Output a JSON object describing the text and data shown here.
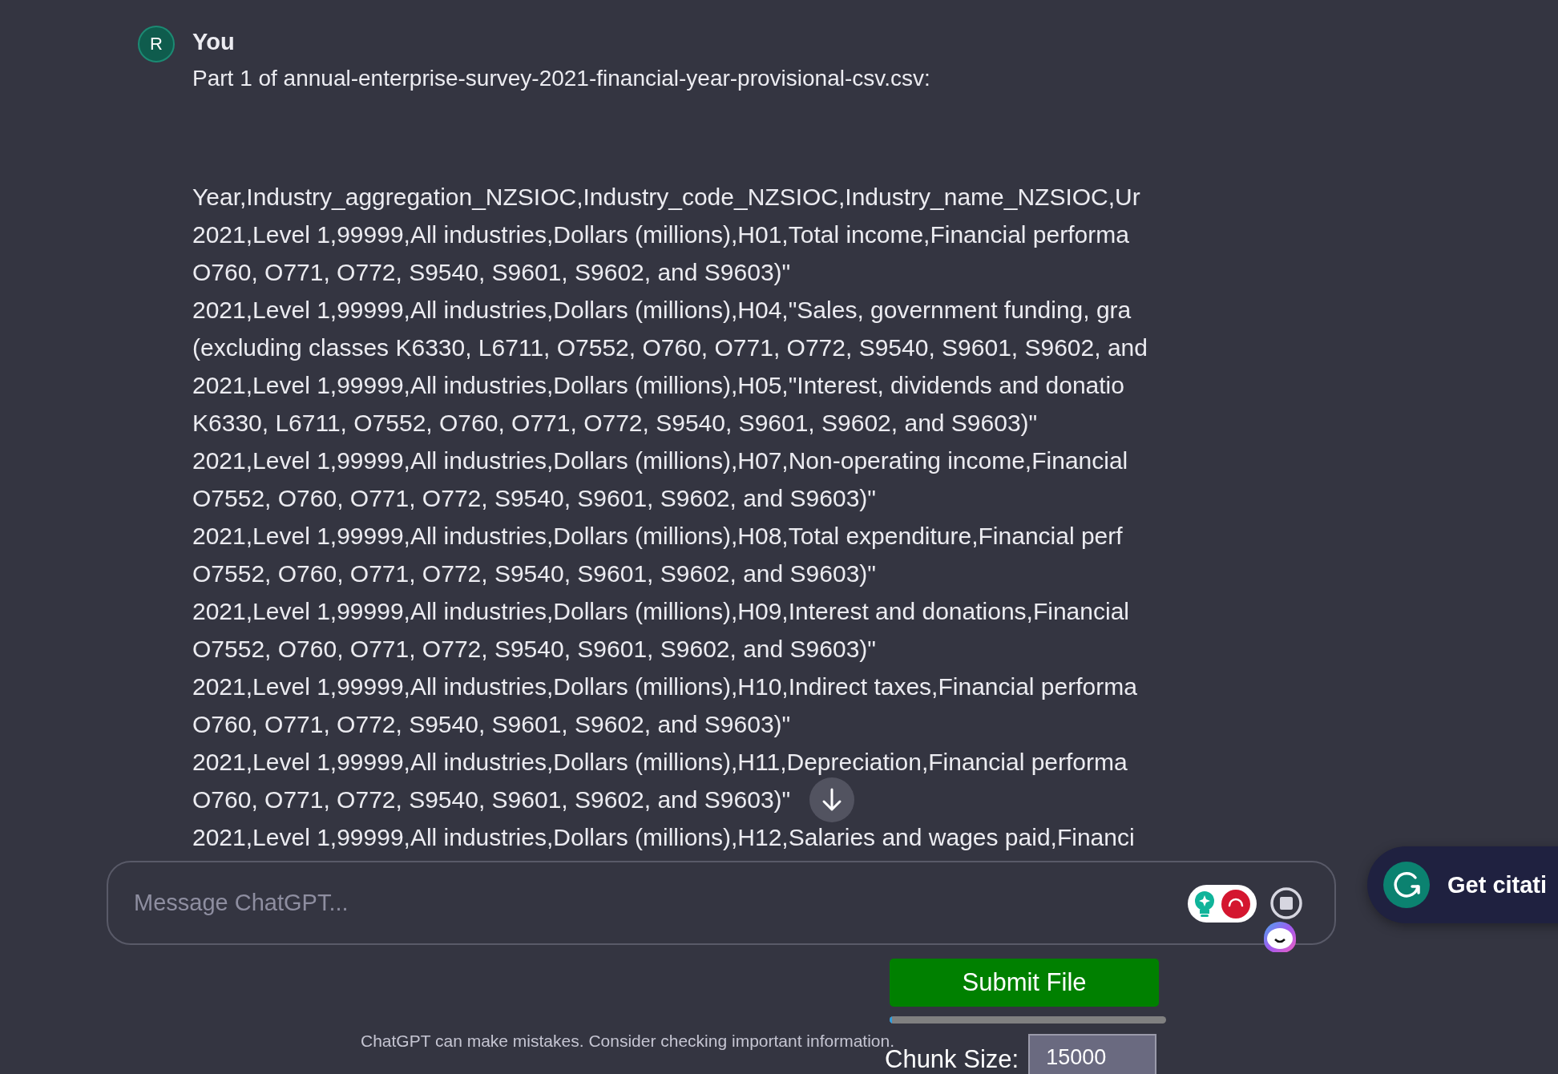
{
  "message": {
    "avatar": "R",
    "author": "You",
    "heading": "Part 1 of annual-enterprise-survey-2021-financial-year-provisional-csv.csv:",
    "lines": [
      "Year,Industry_aggregation_NZSIOC,Industry_code_NZSIOC,Industry_name_NZSIOC,Ur",
      "2021,Level 1,99999,All industries,Dollars (millions),H01,Total income,Financial performa",
      "O760, O771, O772, S9540, S9601, S9602, and S9603)\"",
      "2021,Level 1,99999,All industries,Dollars (millions),H04,\"Sales, government funding, gra",
      "(excluding classes K6330, L6711, O7552, O760, O771, O772, S9540, S9601, S9602, and",
      "2021,Level 1,99999,All industries,Dollars (millions),H05,\"Interest, dividends and donatio",
      "K6330, L6711, O7552, O760, O771, O772, S9540, S9601, S9602, and S9603)\"",
      "2021,Level 1,99999,All industries,Dollars (millions),H07,Non-operating income,Financial",
      "O7552, O760, O771, O772, S9540, S9601, S9602, and S9603)\"",
      "2021,Level 1,99999,All industries,Dollars (millions),H08,Total expenditure,Financial perf",
      "O7552, O760, O771, O772, S9540, S9601, S9602, and S9603)\"",
      "2021,Level 1,99999,All industries,Dollars (millions),H09,Interest and donations,Financial",
      "O7552, O760, O771, O772, S9540, S9601, S9602, and S9603)\"",
      "2021,Level 1,99999,All industries,Dollars (millions),H10,Indirect taxes,Financial performa",
      "O760, O771, O772, S9540, S9601, S9602, and S9603)\"",
      "2021,Level 1,99999,All industries,Dollars (millions),H11,Depreciation,Financial performa",
      "O760, O771, O772, S9540, S9601, S9602, and S9603)\"",
      "2021,Level 1,99999,All industries,Dollars (millions),H12,Salaries and wages paid,Financi"
    ]
  },
  "composer": {
    "placeholder": "Message ChatGPT..."
  },
  "citation_button": {
    "label": "Get citati"
  },
  "uploader": {
    "submit_label": "Submit File",
    "progress": {
      "level": 0.01
    },
    "chunk_label": "Chunk Size:",
    "chunk_value": "15000"
  },
  "footer_note": "ChatGPT can make mistakes. Consider checking important information."
}
